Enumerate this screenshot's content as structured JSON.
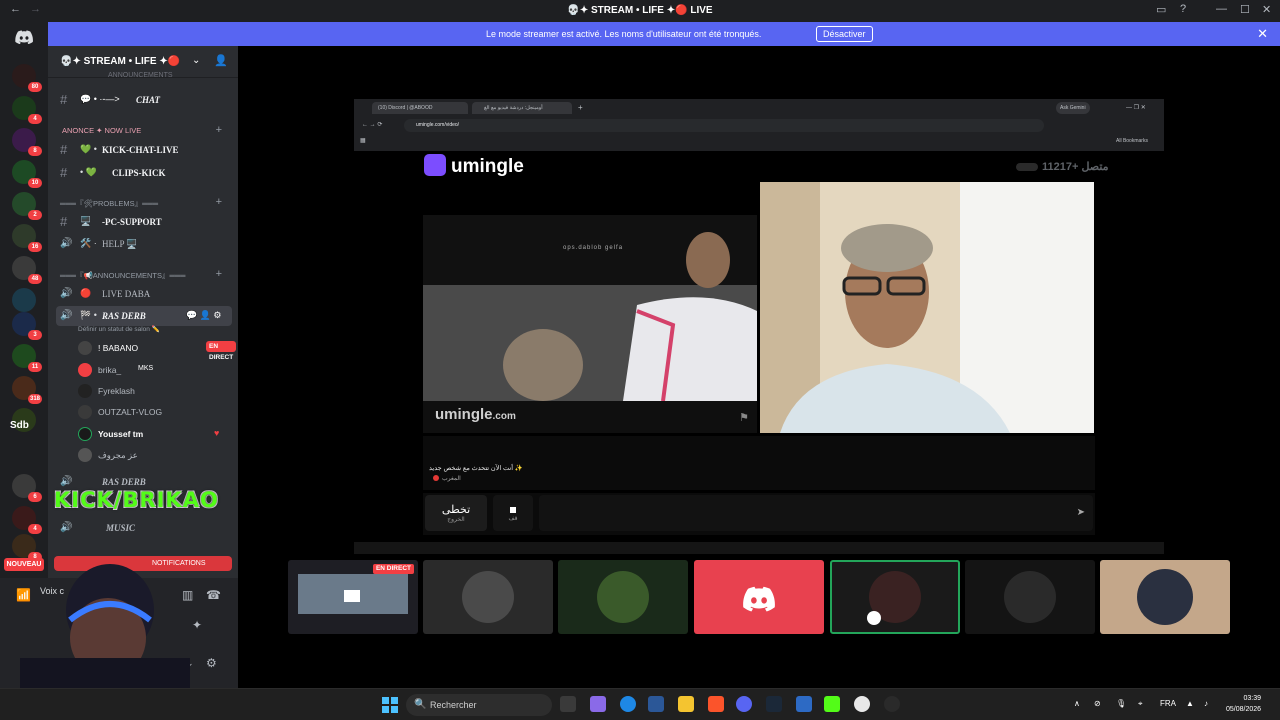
{
  "window": {
    "title": "💀✦ STREAM • LIFE ✦🔴 LIVE"
  },
  "banner": {
    "text": "Le mode streamer est activé. Les noms d'utilisateur ont été tronqués.",
    "button": "Désactiver"
  },
  "servers": {
    "badges": [
      "80",
      "4",
      "8",
      "10",
      "2",
      "16",
      "48",
      "3",
      "11",
      "318",
      "6",
      "4",
      "8"
    ],
    "sdb": "Sdb",
    "nouveau": "NOUVEAU"
  },
  "channels": {
    "server_name": "💀✦ STREAM • LIFE ✦🔴",
    "top_cut": "ANNOUNCEMENTS",
    "items": [
      {
        "type": "text",
        "label": "CHAT",
        "prefix": "💬 • ·-—>"
      },
      {
        "type": "category",
        "label": "ANONCE ✦ NOW LIVE"
      },
      {
        "type": "text",
        "label": "KICK-CHAT-LIVE",
        "prefix": "💚 •"
      },
      {
        "type": "text",
        "label": "CLIPS-KICK",
        "prefix": "• 💚"
      },
      {
        "type": "category",
        "label": "═══『🛠PROBLEMS』═══"
      },
      {
        "type": "text",
        "label": "-PC-SUPPORT",
        "prefix": "🖥️"
      },
      {
        "type": "voice",
        "label": "HELP 🖥️",
        "prefix": "🛠️ ·"
      },
      {
        "type": "category",
        "label": "═══『📢ANNOUNCEMENTS』═══"
      },
      {
        "type": "voice",
        "label": "LIVE DABA",
        "prefix": "🔴"
      },
      {
        "type": "voice",
        "label": "RAS DERB",
        "prefix": "🏁 •"
      }
    ],
    "status_hint": "Définir un statut de salon ✏️",
    "voice_users": [
      {
        "name": "! BABANO",
        "live": "EN DIRECT"
      },
      {
        "name": "brika_",
        "tag": "MKS"
      },
      {
        "name": "Fyreklash"
      },
      {
        "name": "OUTZALT-VLOG"
      },
      {
        "name": "Youssef tm"
      },
      {
        "name": "عز مجروف"
      }
    ],
    "more": [
      {
        "label": "RAS DERB"
      },
      {
        "label": "MUSIC"
      }
    ],
    "notif": "NOTIFICATIONS"
  },
  "overlay": {
    "kick": "KICK/BRIKAO"
  },
  "voice_panel": {
    "label": "Voix c"
  },
  "browser": {
    "tab1": "(10) Discord | @ABOOD",
    "tab2": "أومينجل: دردشة فيديو مع الغ",
    "url": "umingle.com/video/",
    "ask": "Ask Gemini",
    "bookmarks": "All Bookmarks"
  },
  "umingle": {
    "brand": "umingle",
    "online": "11217+ متصل",
    "watermark": "umingle",
    "watermark_tld": ".com",
    "video_caption": "ops.dablob gelfa",
    "message": "✨ أنت الآن تتحدث مع شخص جديد",
    "country": "المغرب",
    "skip_label": "تخطى",
    "skip_sub": "الخروج",
    "stop_sub": "قف"
  },
  "stream_tiles": {
    "live": "EN DIRECT"
  },
  "taskbar": {
    "search": "Rechercher",
    "lang": "FRA",
    "time": "03:39",
    "date": "05/08/2026"
  }
}
